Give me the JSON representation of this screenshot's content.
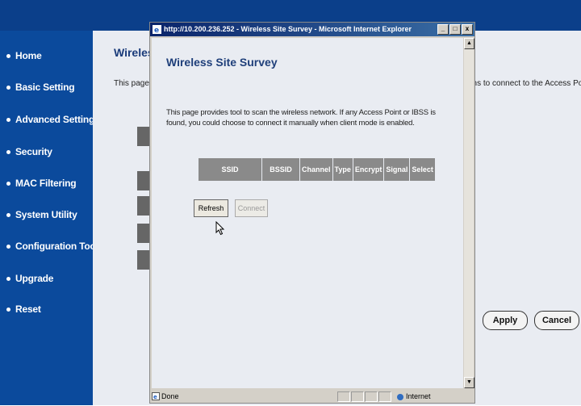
{
  "sidebar": {
    "items": [
      {
        "label": "Home"
      },
      {
        "label": "Basic Setting"
      },
      {
        "label": "Advanced Setting"
      },
      {
        "label": "Security"
      },
      {
        "label": "MAC Filtering"
      },
      {
        "label": "System Utility"
      },
      {
        "label": "Configuration Tool"
      },
      {
        "label": "Upgrade"
      },
      {
        "label": "Reset"
      }
    ]
  },
  "background": {
    "title": "Wireless",
    "text_left": "This page all",
    "text_right": "ons to connect to the Access Point.",
    "apply_label": "Apply",
    "cancel_label": "Cancel"
  },
  "window": {
    "title": "http://10.200.236.252 - Wireless Site Survey - Microsoft Internet Explorer",
    "minimize": "_",
    "maximize": "□",
    "close": "x"
  },
  "popup": {
    "title": "Wireless Site Survey",
    "description": "This page provides tool to scan the wireless network. If any Access Point or IBSS is found, you could choose to connect it manually when client mode is enabled.",
    "table_headers": [
      "SSID",
      "BSSID",
      "Channel",
      "Type",
      "Encrypt",
      "Signal",
      "Select"
    ],
    "refresh_label": "Refresh",
    "connect_label": "Connect"
  },
  "status": {
    "left": "Done",
    "zone": "Internet"
  },
  "colors": {
    "sidebar": "#0b4a9c",
    "content_bg": "#e9ecf2",
    "table_header": "#8a8a8a",
    "titlebar": "#0a246a"
  }
}
